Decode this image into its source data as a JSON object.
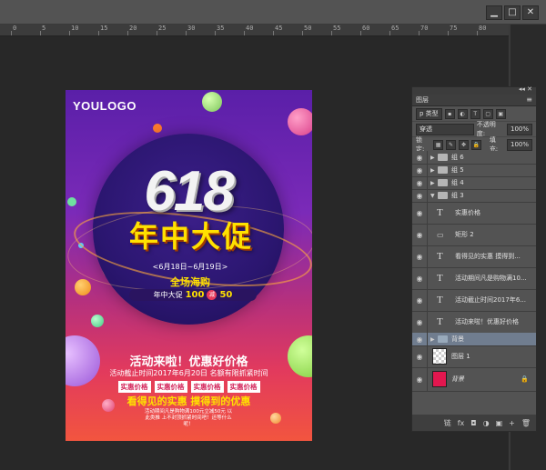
{
  "window": {
    "minimize": "▁",
    "maximize": "□",
    "close": "✕"
  },
  "ruler": {
    "marks": [
      "0",
      "5",
      "10",
      "15",
      "20",
      "25",
      "30",
      "35",
      "40",
      "45",
      "50",
      "55",
      "60",
      "65",
      "70",
      "75",
      "80"
    ]
  },
  "poster": {
    "logo": "YOULOGO",
    "big_number": "618",
    "main_title": "年中大促",
    "date_range": "<6月18日~6月19日>",
    "slogan": "全场海购",
    "promo_label": "年中大促",
    "promo_amount": "100",
    "promo_mid": "减",
    "promo_discount": "50",
    "headline": "活动来啦！优惠好价格",
    "deadline": "活动截止时间2017年6月20日  名额有限抓紧时间",
    "tags": [
      "实惠价格",
      "实惠价格",
      "实惠价格",
      "实惠价格"
    ],
    "sub_headline": "看得见的实惠 摸得到的优惠",
    "fine_print": "活动期间凡是购物满100元立减50元 以此类推 上不封顶抓紧时间吧！还等什么呢！"
  },
  "layers_panel": {
    "tab": "图层",
    "kind_filter": "p 类型",
    "blend_mode": "穿透",
    "opacity_label": "不透明度:",
    "opacity_value": "100%",
    "lock_label": "锁定:",
    "fill_label": "填充:",
    "fill_value": "100%",
    "layers": [
      {
        "type": "group",
        "name": "组 6"
      },
      {
        "type": "group",
        "name": "组 5"
      },
      {
        "type": "group",
        "name": "组 4"
      },
      {
        "type": "group-open",
        "name": "组 3"
      },
      {
        "type": "text",
        "name": "实惠价格"
      },
      {
        "type": "shape",
        "name": "矩形 2"
      },
      {
        "type": "text",
        "name": "看得见的实惠 摸得到..."
      },
      {
        "type": "text",
        "name": "活动期间凡是购物满10..."
      },
      {
        "type": "text",
        "name": "活动截止时间2017年6..."
      },
      {
        "type": "text",
        "name": "活动来啦！优惠好价格"
      },
      {
        "type": "group-selected",
        "name": "背景"
      },
      {
        "type": "image",
        "name": "图层 1"
      },
      {
        "type": "bg",
        "name": "背景"
      }
    ],
    "footer_icons": [
      "链",
      "fx",
      "◘",
      "◑",
      "▣",
      "+",
      "🗑"
    ]
  },
  "colors": {
    "poster_top": "#5a1fa8",
    "poster_bottom": "#f2553f",
    "accent_yellow": "#ffe100",
    "layer_select": "#707d8f"
  }
}
